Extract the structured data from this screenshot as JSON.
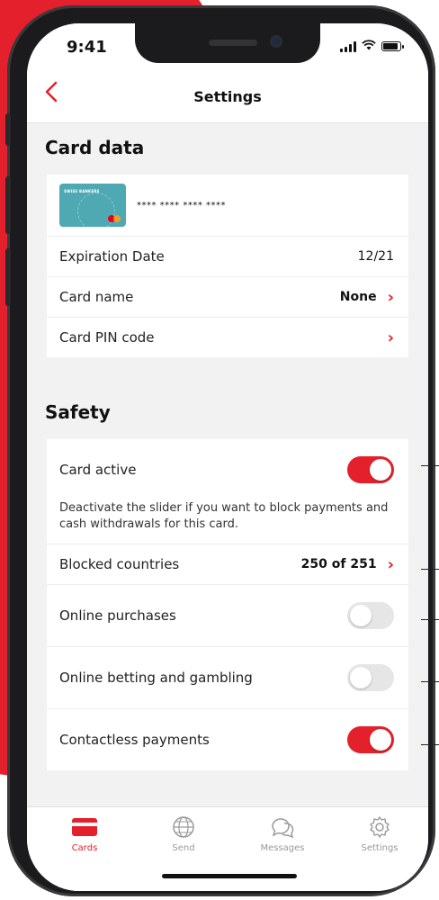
{
  "status": {
    "time": "9:41"
  },
  "nav": {
    "title": "Settings",
    "back_icon": "chevron-left-icon"
  },
  "card_data": {
    "title": "Card data",
    "card_brand": "SWISS BANKERS",
    "card_number": "**** **** **** ****",
    "rows": [
      {
        "label": "Expiration Date",
        "value": "12/21"
      },
      {
        "label": "Card name",
        "value": "None"
      },
      {
        "label": "Card PIN code",
        "value": ""
      }
    ]
  },
  "safety": {
    "title": "Safety",
    "card_active": {
      "label": "Card active",
      "on": true
    },
    "description": "Deactivate the slider if you want to block payments and cash withdrawals for this card.",
    "blocked_countries": {
      "label": "Blocked countries",
      "value": "250 of 251"
    },
    "online_purchases": {
      "label": "Online purchases",
      "on": false
    },
    "online_betting": {
      "label": "Online betting and gambling",
      "on": false
    },
    "contactless": {
      "label": "Contactless payments",
      "on": true
    }
  },
  "tabs": [
    {
      "label": "Cards",
      "icon": "card-icon",
      "active": true
    },
    {
      "label": "Send",
      "icon": "globe-icon",
      "active": false
    },
    {
      "label": "Messages",
      "icon": "chat-bubbles-icon",
      "active": false
    },
    {
      "label": "Settings",
      "icon": "gear-icon",
      "active": false
    }
  ],
  "colors": {
    "accent": "#e3202b",
    "background": "#f2f2f2",
    "toggle_off": "#e6e6e6"
  }
}
